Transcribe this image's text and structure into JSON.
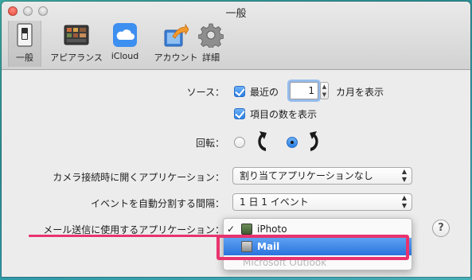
{
  "window": {
    "title": "一般"
  },
  "toolbar": {
    "items": [
      {
        "label": "一般",
        "icon": "general-switch-icon",
        "selected": true
      },
      {
        "label": "アピアランス",
        "icon": "appearance-icon"
      },
      {
        "label": "iCloud",
        "icon": "icloud-icon"
      },
      {
        "label": "アカウント",
        "icon": "account-icon"
      },
      {
        "label": "詳細",
        "icon": "gear-icon"
      }
    ]
  },
  "source": {
    "label": "ソース：",
    "recent_label": "最近の",
    "recent_value": "1",
    "recent_suffix": "カ月を表示",
    "item_count_label": "項目の数を表示"
  },
  "rotation": {
    "label": "回転："
  },
  "camera": {
    "label": "カメラ接続時に開くアプリケーション：",
    "value": "割り当てアプリケーションなし"
  },
  "events": {
    "label": "イベントを自動分割する間隔：",
    "value": "1 日 1 イベント"
  },
  "mail": {
    "label": "メール送信に使用するアプリケーション：",
    "options": [
      {
        "label": "iPhoto",
        "checked": true
      },
      {
        "label": "Mail",
        "selected": true
      },
      {
        "label": "Microsoft Outlook",
        "disabled": true
      }
    ]
  },
  "help": {
    "label": "?"
  },
  "colors": {
    "accent": "#2b73dd",
    "annotation": "#e8336e"
  }
}
